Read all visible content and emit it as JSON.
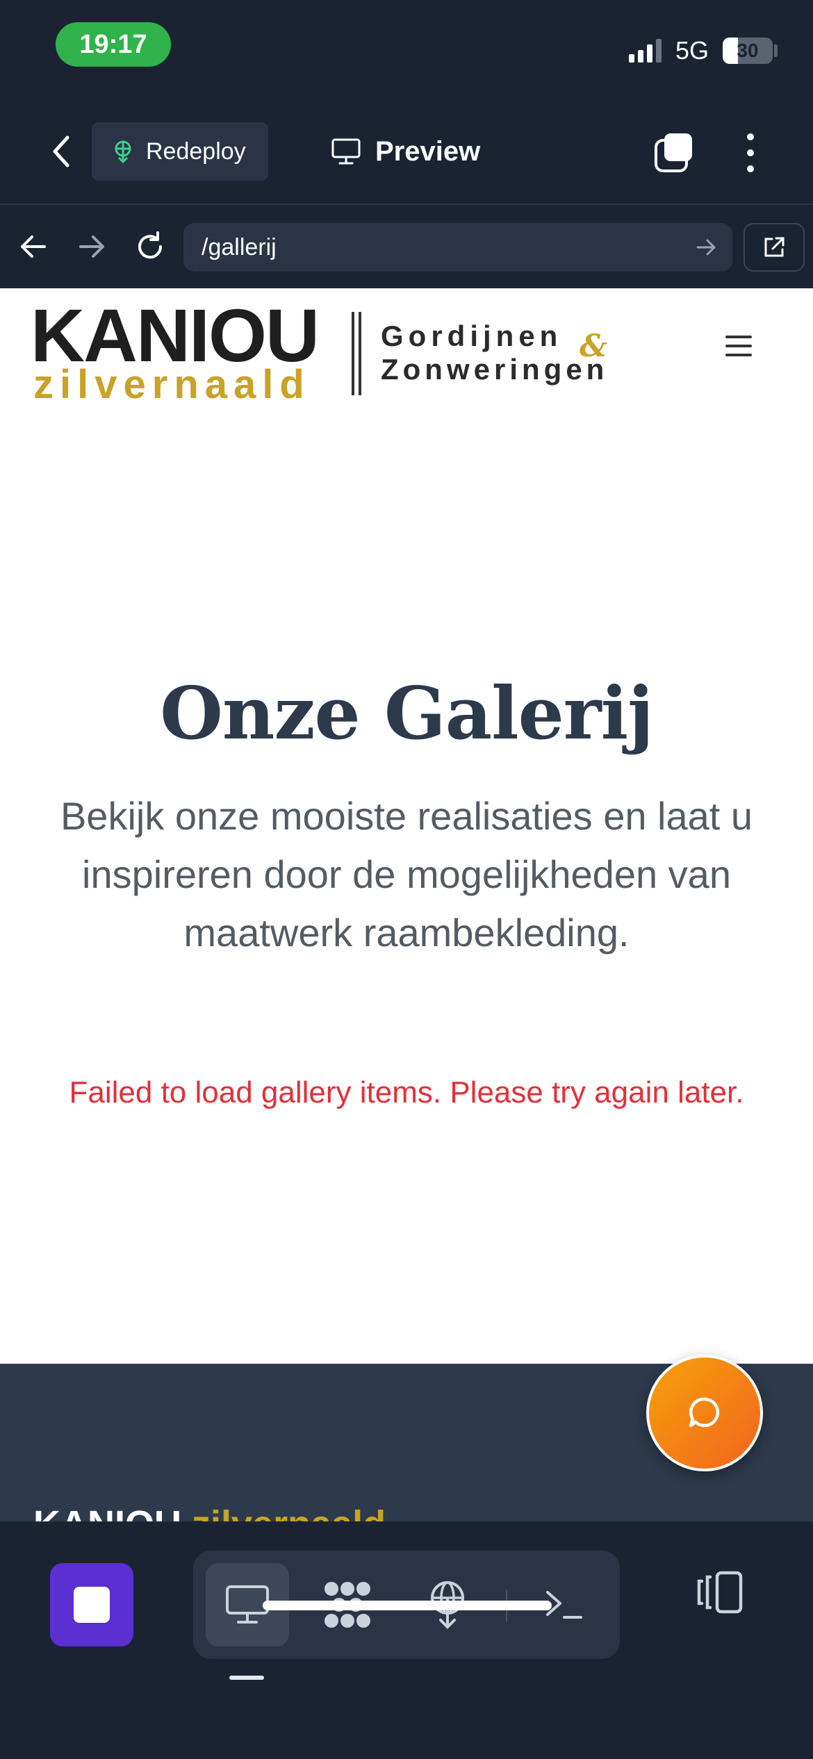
{
  "status_bar": {
    "time": "19:17",
    "network": "5G",
    "battery": "30",
    "battery_level": 0.3
  },
  "app_bar": {
    "redeploy_label": "Redeploy",
    "preview_label": "Preview",
    "icons": [
      "back-icon",
      "redeploy-icon",
      "monitor-icon",
      "tabs-icon",
      "more-vertical-icon"
    ]
  },
  "url_bar": {
    "url": "/gallerij",
    "icons": [
      "arrow-left-icon",
      "arrow-right-icon",
      "reload-icon",
      "go-arrow-icon",
      "external-link-icon"
    ]
  },
  "site": {
    "logo": {
      "brand": "KANIOU",
      "sub": "zilvernaald",
      "line1": "Gordijnen",
      "amp": "&",
      "line2": "Zonweringen"
    },
    "title": "Onze Galerij",
    "subtitle": "Bekijk onze mooiste realisaties en laat u inspireren door de mogelijkheden van maatwerk raambekleding.",
    "error": "Failed to load gallery items. Please try again later.",
    "footer_brand": "KANIOU",
    "footer_brand_sub": "zilvernaald"
  },
  "colors": {
    "accent": "#5b2fd1",
    "gold": "#c9a227",
    "error": "#e0303a",
    "fab_start": "#f7a10a",
    "fab_end": "#f2641e",
    "dark": "#1b2333"
  },
  "bottom_bar": {
    "icons": [
      "stop-icon",
      "monitor-icon",
      "workflow-icon",
      "deploy-icon",
      "terminal-icon",
      "panels-icon"
    ]
  }
}
